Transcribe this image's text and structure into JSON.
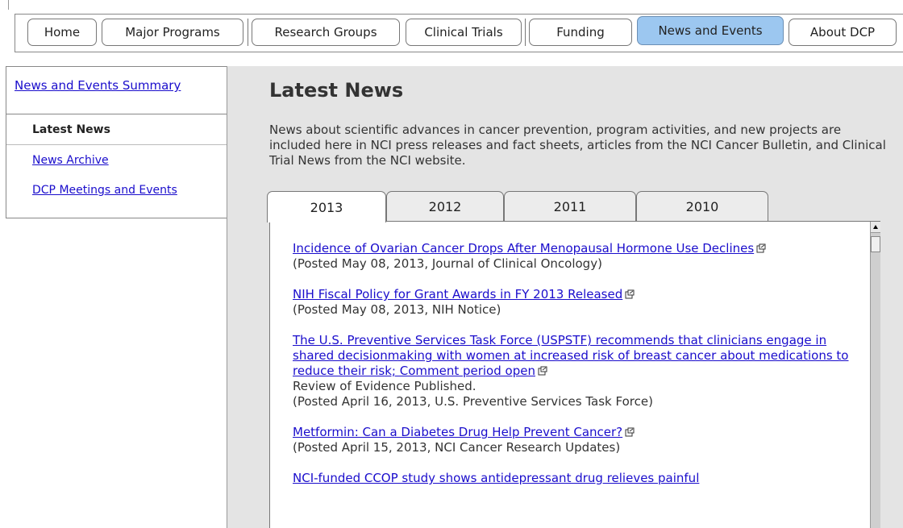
{
  "topnav": {
    "items": [
      "Home",
      "Major Programs",
      "Research Groups",
      "Clinical Trials",
      "Funding",
      "News and Events",
      "About DCP"
    ],
    "active": "News and Events"
  },
  "sidebar": {
    "summary_link": "News and Events Summary",
    "current": "Latest News",
    "links": [
      "News Archive",
      "DCP Meetings and Events"
    ]
  },
  "main": {
    "title": "Latest News",
    "intro": "News about scientific advances in cancer prevention, program activities, and new projects are included here in NCI press releases and fact sheets, articles from the NCI Cancer Bulletin, and Clinical Trial News from the NCI website.",
    "year_tabs": [
      "2013",
      "2012",
      "2011",
      "2010"
    ],
    "active_year": "2013",
    "news": [
      {
        "link": "Incidence of Ovarian Cancer Drops After Menopausal Hormone Use Declines",
        "extra": "",
        "posted": "(Posted May 08, 2013, Journal of Clinical Oncology)"
      },
      {
        "link": "NIH Fiscal Policy for Grant Awards in FY 2013 Released",
        "extra": "",
        "posted": "(Posted May 08, 2013, NIH Notice)"
      },
      {
        "link": "The U.S. Preventive Services Task Force (USPSTF) recommends that clinicians engage in shared decisionmaking with women at increased risk of breast cancer about medications to reduce their risk; Comment period open",
        "extra": "Review of Evidence Published.",
        "posted": "(Posted April 16, 2013, U.S. Preventive Services Task Force)"
      },
      {
        "link": "Metformin: Can a Diabetes Drug Help Prevent Cancer?",
        "extra": "",
        "posted": "(Posted April 15, 2013, NCI Cancer Research Updates)"
      },
      {
        "link": "NCI-funded CCOP study shows antidepressant drug relieves painful",
        "extra": "",
        "posted": ""
      }
    ]
  },
  "icons": {
    "external_link": "external-link-icon"
  },
  "colors": {
    "link": "#1a0dcc",
    "active_tab": "#9cc7f0",
    "main_bg": "#e4e4e4"
  }
}
